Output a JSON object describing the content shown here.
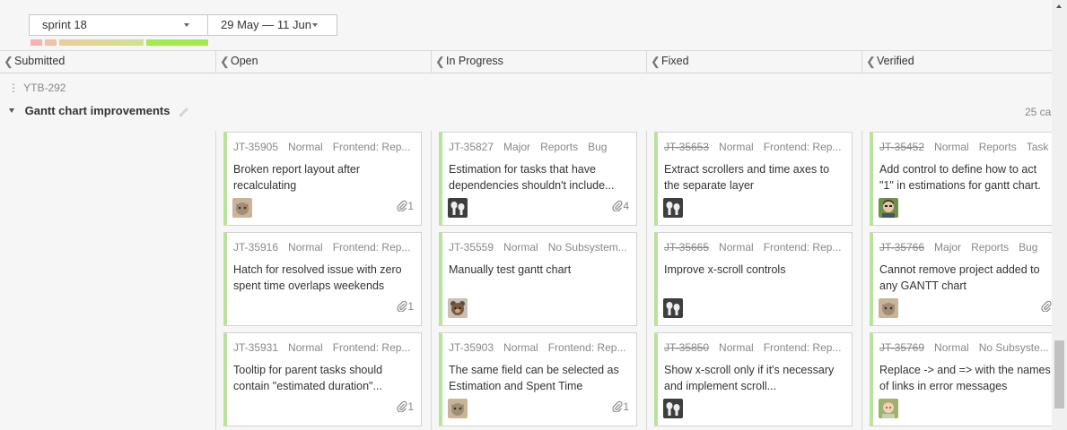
{
  "toolbar": {
    "sprint": "sprint 18",
    "dates": "29 May — 11 Jun"
  },
  "columns": [
    {
      "label": "Submitted"
    },
    {
      "label": "Open"
    },
    {
      "label": "In Progress"
    },
    {
      "label": "Fixed"
    },
    {
      "label": "Verified"
    }
  ],
  "swimlane": {
    "id": "YTB-292",
    "title": "Gantt chart improvements",
    "count": "25 ca"
  },
  "cards": [
    {
      "id": "JT-35905",
      "priority": "Normal",
      "subsystem": "Frontend: Rep...",
      "summary": "Broken report layout after recalculating",
      "attachments": "1",
      "avatar": "cat",
      "resolved": false
    },
    {
      "id": "JT-35827",
      "priority": "Major",
      "subsystem": "Reports",
      "type": "Bug",
      "summary": "Estimation for tasks that have dependencies shouldn't include...",
      "attachments": "4",
      "avatar": "duo",
      "resolved": false
    },
    {
      "id": "JT-35653",
      "priority": "Normal",
      "subsystem": "Frontend: Rep...",
      "summary": "Extract scrollers and time axes to the separate layer",
      "attachments": "",
      "avatar": "duo",
      "resolved": true
    },
    {
      "id": "JT-35452",
      "priority": "Normal",
      "subsystem": "Reports",
      "type": "Task",
      "summary": "Add control to define how to act \"1\" in estimations for gantt chart.",
      "attachments": "",
      "avatar": "man",
      "resolved": true
    },
    {
      "id": "JT-35916",
      "priority": "Normal",
      "subsystem": "Frontend: Rep...",
      "summary": "Hatch for resolved issue with zero spent time overlaps weekends",
      "attachments": "1",
      "avatar": "",
      "resolved": false
    },
    {
      "id": "JT-35559",
      "priority": "Normal",
      "subsystem": "No Subsystem...",
      "summary": "Manually test gantt chart",
      "attachments": "",
      "avatar": "bear",
      "resolved": false
    },
    {
      "id": "JT-35665",
      "priority": "Normal",
      "subsystem": "Frontend: Rep...",
      "summary": "Improve x-scroll controls",
      "attachments": "",
      "avatar": "duo",
      "resolved": true
    },
    {
      "id": "JT-35766",
      "priority": "Major",
      "subsystem": "Reports",
      "type": "Bug",
      "summary": "Cannot remove project added to any GANTT chart",
      "attachments": "clip",
      "avatar": "cat",
      "resolved": true
    },
    {
      "id": "JT-35931",
      "priority": "Normal",
      "subsystem": "Frontend: Rep...",
      "summary": "Tooltip for parent tasks should contain \"estimated duration\"...",
      "attachments": "1",
      "avatar": "",
      "resolved": false
    },
    {
      "id": "JT-35903",
      "priority": "Normal",
      "subsystem": "Frontend: Rep...",
      "summary": "The same field can be selected as Estimation and Spent Time",
      "attachments": "1",
      "avatar": "cat",
      "resolved": false
    },
    {
      "id": "JT-35850",
      "priority": "Normal",
      "subsystem": "Frontend: Rep...",
      "summary": "Show x-scroll only if it's necessary and implement scroll...",
      "attachments": "",
      "avatar": "duo",
      "resolved": true
    },
    {
      "id": "JT-35769",
      "priority": "Normal",
      "subsystem": "No Subsyste...",
      "summary": "Replace -> and => with the names of links in error messages",
      "attachments": "",
      "avatar": "man2",
      "resolved": true
    }
  ],
  "colors": {
    "card_accent": "#b9e29b",
    "burn_red": "#f6b3ac",
    "burn_yellow": "#dbe39a",
    "burn_green": "#a2ec4a"
  }
}
